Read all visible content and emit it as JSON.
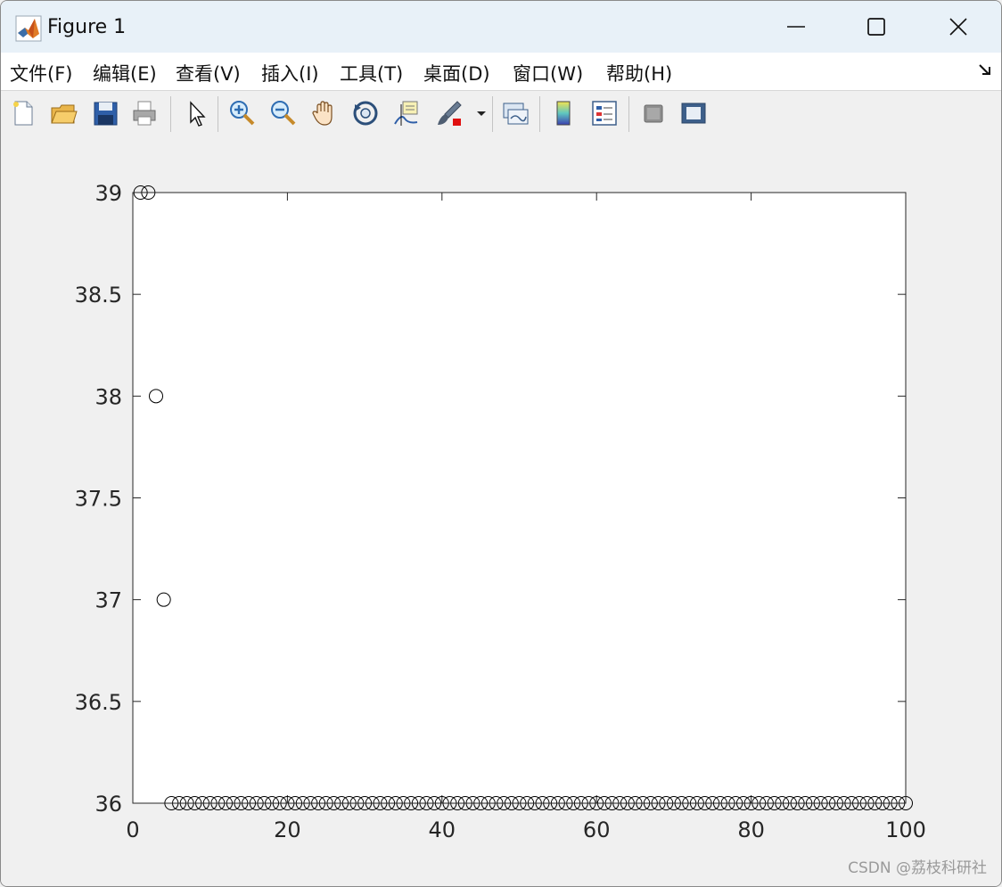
{
  "window": {
    "title": "Figure 1"
  },
  "menu": {
    "items": [
      "文件(F)",
      "编辑(E)",
      "查看(V)",
      "插入(I)",
      "工具(T)",
      "桌面(D)",
      "窗口(W)",
      "帮助(H)"
    ]
  },
  "toolbar": {
    "tools": [
      {
        "name": "new-figure-icon"
      },
      {
        "name": "open-file-icon"
      },
      {
        "name": "save-icon"
      },
      {
        "name": "print-icon"
      },
      {
        "name": "select-pointer-icon"
      },
      {
        "name": "zoom-in-icon"
      },
      {
        "name": "zoom-out-icon"
      },
      {
        "name": "pan-hand-icon"
      },
      {
        "name": "rotate-3d-icon"
      },
      {
        "name": "data-cursor-icon"
      },
      {
        "name": "brush-icon"
      },
      {
        "name": "link-plot-icon"
      },
      {
        "name": "colorbar-icon"
      },
      {
        "name": "legend-icon"
      },
      {
        "name": "hide-plot-tools-icon"
      },
      {
        "name": "show-plot-tools-icon"
      }
    ]
  },
  "chart_data": {
    "type": "scatter",
    "marker": "circle-open",
    "color": "#000000",
    "xlim": [
      0,
      100
    ],
    "ylim": [
      36,
      39
    ],
    "xticks": [
      0,
      20,
      40,
      60,
      80,
      100
    ],
    "yticks": [
      36,
      36.5,
      37,
      37.5,
      38,
      38.5,
      39
    ],
    "xtick_labels": [
      "0",
      "20",
      "40",
      "60",
      "80",
      "100"
    ],
    "ytick_labels": [
      "36",
      "36.5",
      "37",
      "37.5",
      "38",
      "38.5",
      "39"
    ],
    "x": [
      1,
      2,
      3,
      4,
      5,
      6,
      7,
      8,
      9,
      10,
      11,
      12,
      13,
      14,
      15,
      16,
      17,
      18,
      19,
      20,
      21,
      22,
      23,
      24,
      25,
      26,
      27,
      28,
      29,
      30,
      31,
      32,
      33,
      34,
      35,
      36,
      37,
      38,
      39,
      40,
      41,
      42,
      43,
      44,
      45,
      46,
      47,
      48,
      49,
      50,
      51,
      52,
      53,
      54,
      55,
      56,
      57,
      58,
      59,
      60,
      61,
      62,
      63,
      64,
      65,
      66,
      67,
      68,
      69,
      70,
      71,
      72,
      73,
      74,
      75,
      76,
      77,
      78,
      79,
      80,
      81,
      82,
      83,
      84,
      85,
      86,
      87,
      88,
      89,
      90,
      91,
      92,
      93,
      94,
      95,
      96,
      97,
      98,
      99,
      100
    ],
    "y": [
      39,
      39,
      38,
      37,
      36,
      36,
      36,
      36,
      36,
      36,
      36,
      36,
      36,
      36,
      36,
      36,
      36,
      36,
      36,
      36,
      36,
      36,
      36,
      36,
      36,
      36,
      36,
      36,
      36,
      36,
      36,
      36,
      36,
      36,
      36,
      36,
      36,
      36,
      36,
      36,
      36,
      36,
      36,
      36,
      36,
      36,
      36,
      36,
      36,
      36,
      36,
      36,
      36,
      36,
      36,
      36,
      36,
      36,
      36,
      36,
      36,
      36,
      36,
      36,
      36,
      36,
      36,
      36,
      36,
      36,
      36,
      36,
      36,
      36,
      36,
      36,
      36,
      36,
      36,
      36,
      36,
      36,
      36,
      36,
      36,
      36,
      36,
      36,
      36,
      36,
      36,
      36,
      36,
      36,
      36,
      36,
      36,
      36,
      36,
      36
    ]
  },
  "watermark": "CSDN @荔枝科研社"
}
